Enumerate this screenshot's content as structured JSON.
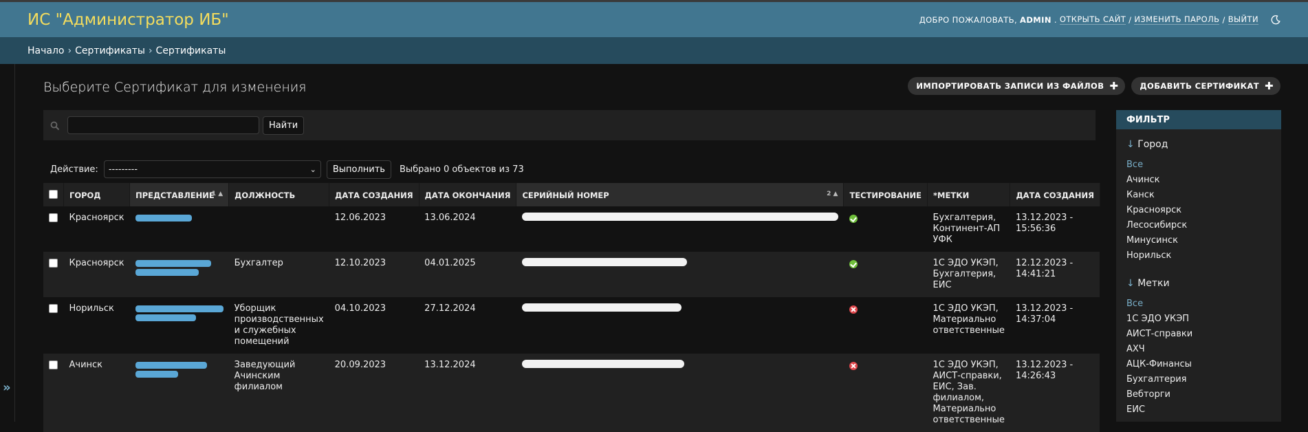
{
  "header": {
    "title": "ИС \"Администратор ИБ\"",
    "welcome": "Добро пожаловать,",
    "username": "admin",
    "view_site": "Открыть сайт",
    "change_password": "Изменить пароль",
    "logout": "Выйти",
    "separator": "/"
  },
  "breadcrumbs": [
    "Начало",
    "Сертификаты",
    "Сертификаты"
  ],
  "page": {
    "title": "Выберите Сертификат для изменения",
    "import_label": "Импортировать записи из файлов",
    "add_label": "Добавить Сертификат"
  },
  "search": {
    "placeholder": "",
    "button": "Найти"
  },
  "actions": {
    "label": "Действие:",
    "selected": "---------",
    "run": "Выполнить",
    "counter": "Выбрано 0 объектов из 73"
  },
  "table": {
    "columns": [
      "Город",
      "Представление",
      "Должность",
      "Дата создания",
      "Дата окончания",
      "Серийный номер",
      "Тестирование",
      "*Метки",
      "Дата создания"
    ],
    "sort_marks": {
      "representation": "1",
      "serial": "2"
    },
    "rows": [
      {
        "city": "Красноярск",
        "position": "",
        "created": "12.06.2023",
        "expires": "13.06.2024",
        "testing": "yes",
        "tags": "Бухгалтерия, Континент-АП УФК",
        "added": "13.12.2023 - 15:56:36"
      },
      {
        "city": "Красноярск",
        "position": "Бухгалтер",
        "created": "12.10.2023",
        "expires": "04.01.2025",
        "testing": "yes",
        "tags": "1С ЭДО УКЭП, Бухгалтерия, ЕИС",
        "added": "12.12.2023 - 14:41:21"
      },
      {
        "city": "Норильск",
        "position": "Уборщик производственных и служебных помещений",
        "created": "04.10.2023",
        "expires": "27.12.2024",
        "testing": "no",
        "tags": "1С ЭДО УКЭП, Материально ответственные",
        "added": "13.12.2023 - 14:37:04"
      },
      {
        "city": "Ачинск",
        "position": "Заведующий Ачинским филиалом",
        "created": "20.09.2023",
        "expires": "13.12.2024",
        "testing": "no",
        "tags": "1С ЭДО УКЭП, АИСТ-справки, ЕИС, Зав. филиалом, Материально ответственные",
        "added": "13.12.2023 - 14:26:43"
      }
    ]
  },
  "filter": {
    "title": "Фильтр",
    "city_heading": "Город",
    "city_options": [
      "Все",
      "Ачинск",
      "Канск",
      "Красноярск",
      "Лесосибирск",
      "Минусинск",
      "Норильск"
    ],
    "tags_heading": "Метки",
    "tags_options": [
      "Все",
      "1С ЭДО УКЭП",
      "АИСТ-справки",
      "АХЧ",
      "АЦК-Финансы",
      "Бухгалтерия",
      "Вебторги",
      "ЕИС"
    ]
  },
  "colors": {
    "header": "#417690",
    "breadcrumbs": "#264b5d",
    "brand": "#f5dd5d",
    "link": "#79aec8"
  }
}
